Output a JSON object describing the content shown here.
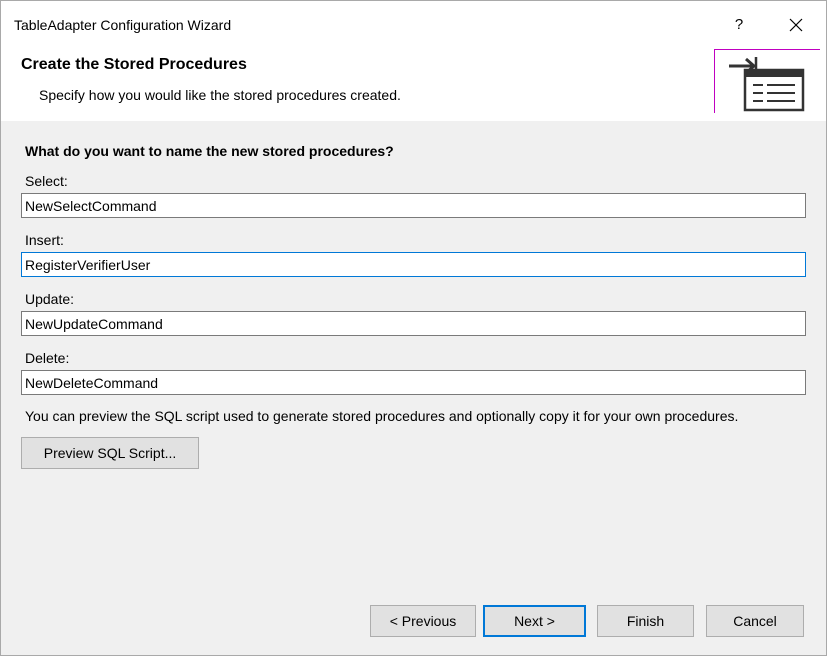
{
  "window": {
    "title": "TableAdapter Configuration Wizard",
    "help": "?"
  },
  "header": {
    "title": "Create the Stored Procedures",
    "subtitle": "Specify how you would like the stored procedures created."
  },
  "form": {
    "question": "What do you want to name the new stored procedures?",
    "fields": [
      {
        "label": "Select:",
        "value": "NewSelectCommand"
      },
      {
        "label": "Insert:",
        "value": "RegisterVerifierUser"
      },
      {
        "label": "Update:",
        "value": "NewUpdateCommand"
      },
      {
        "label": "Delete:",
        "value": "NewDeleteCommand"
      }
    ],
    "info": "You can preview the SQL script used to generate stored procedures and optionally copy it for your own procedures.",
    "preview_button": "Preview SQL Script..."
  },
  "footer": {
    "previous": "< Previous",
    "next": "Next >",
    "finish": "Finish",
    "cancel": "Cancel"
  },
  "colors": {
    "accent": "#0078d7",
    "header_border": "#c000c0"
  },
  "icons": {
    "close": "close-icon",
    "wizard": "wizard-arrow-list-icon"
  }
}
